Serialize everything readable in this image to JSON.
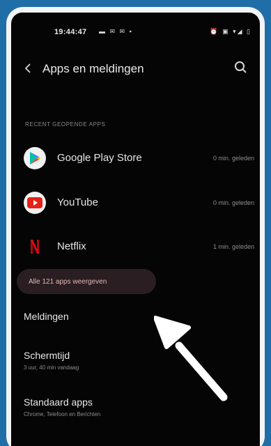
{
  "status_bar": {
    "time": "19:44:47",
    "left_icons": "▬ ✉ ✉ ▪",
    "right_icons": "⏰ ▣ ▾◢ ▯"
  },
  "header": {
    "title": "Apps en meldingen"
  },
  "recent_section": {
    "label": "RECENT GEOPENDE APPS"
  },
  "recent_apps": [
    {
      "name": "Google Play Store",
      "time": "0 min. geleden",
      "icon": "google-play-icon"
    },
    {
      "name": "YouTube",
      "time": "0 min. geleden",
      "icon": "youtube-icon"
    },
    {
      "name": "Netflix",
      "time": "1 min. geleden",
      "icon": "netflix-icon"
    }
  ],
  "all_apps_button": {
    "label": "Alle 121 apps weergeven"
  },
  "menu": [
    {
      "title": "Meldingen",
      "subtitle": ""
    },
    {
      "title": "Schermtijd",
      "subtitle": "3 uur, 40 min vandaag"
    },
    {
      "title": "Standaard apps",
      "subtitle": "Chrome, Telefoon en Berichten"
    }
  ],
  "colors": {
    "background": "#1f6ea8",
    "screen": "#050505",
    "chip": "#2a1e22",
    "youtube_red": "#e62117",
    "netflix_red": "#e50914"
  }
}
